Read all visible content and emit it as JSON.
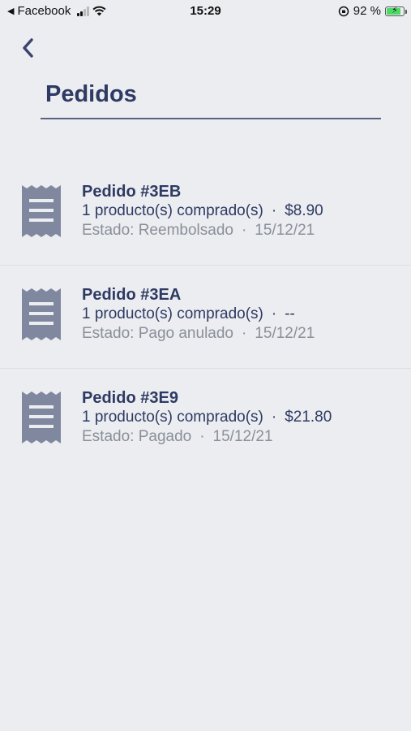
{
  "status_bar": {
    "back_app": "Facebook",
    "time": "15:29",
    "battery": "92 %",
    "battery_level": 0.92
  },
  "page": {
    "title": "Pedidos"
  },
  "orders": [
    {
      "title": "Pedido #3EB",
      "products": "1 producto(s) comprado(s)",
      "price": "$8.90",
      "state": "Estado: Reembolsado",
      "date": "15/12/21"
    },
    {
      "title": "Pedido #3EA",
      "products": "1 producto(s) comprado(s)",
      "price": "--",
      "state": "Estado: Pago anulado",
      "date": "15/12/21"
    },
    {
      "title": "Pedido #3E9",
      "products": "1 producto(s) comprado(s)",
      "price": "$21.80",
      "state": "Estado: Pagado",
      "date": "15/12/21"
    }
  ],
  "separator": "·",
  "icons": {
    "back": "chevron-left-icon",
    "order": "receipt-icon",
    "wifi": "wifi-icon",
    "signal": "signal-icon",
    "lock": "orientation-lock-icon",
    "battery": "battery-icon"
  },
  "colors": {
    "background": "#ebedf0",
    "primary": "#2e3a63",
    "secondary": "#8a8f99",
    "icon": "#8088a0"
  }
}
